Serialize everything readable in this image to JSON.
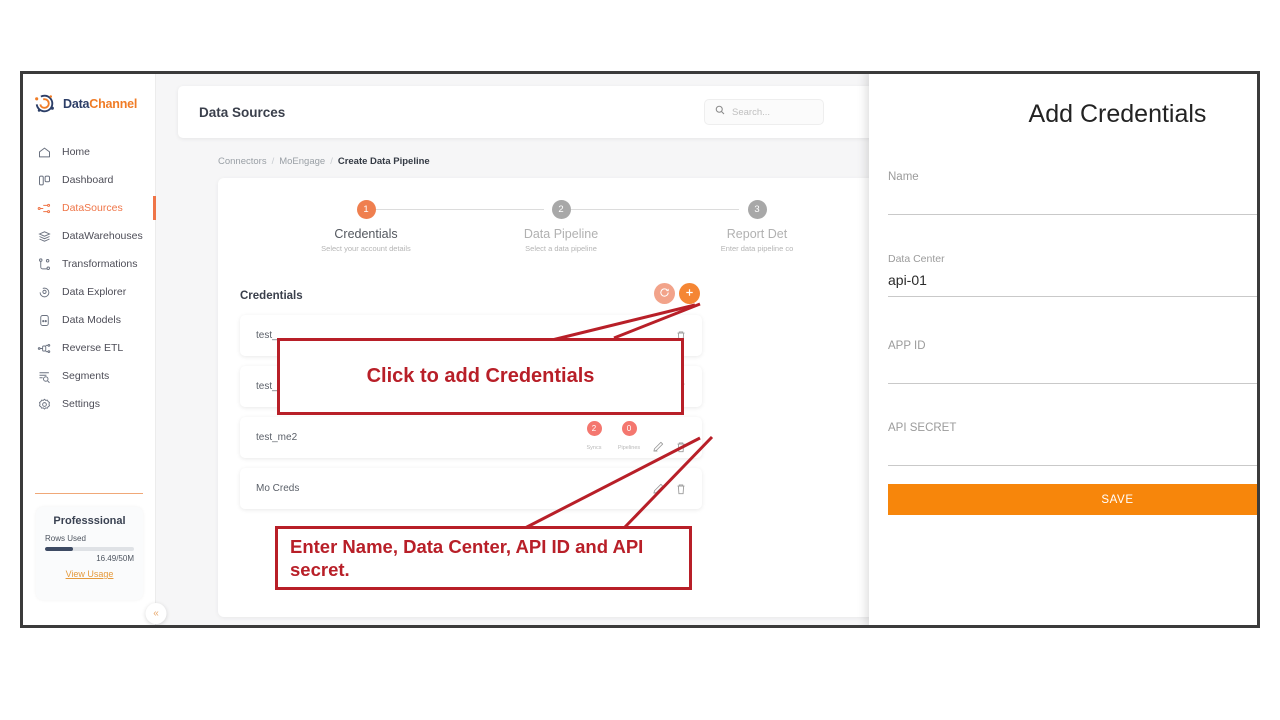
{
  "app": {
    "brand_data": "Data",
    "brand_channel": "Channel",
    "logo_icon": "datachannel-logo-icon"
  },
  "sidebar": {
    "items": [
      {
        "label": "Home",
        "icon": "home-icon",
        "active": false
      },
      {
        "label": "Dashboard",
        "icon": "dashboard-icon",
        "active": false
      },
      {
        "label": "DataSources",
        "icon": "datasources-icon",
        "active": true
      },
      {
        "label": "DataWarehouses",
        "icon": "datawarehouses-icon",
        "active": false
      },
      {
        "label": "Transformations",
        "icon": "transformations-icon",
        "active": false
      },
      {
        "label": "Data Explorer",
        "icon": "data-explorer-icon",
        "active": false
      },
      {
        "label": "Data Models",
        "icon": "data-models-icon",
        "active": false
      },
      {
        "label": "Reverse ETL",
        "icon": "reverse-etl-icon",
        "active": false
      },
      {
        "label": "Segments",
        "icon": "segments-icon",
        "active": false
      },
      {
        "label": "Settings",
        "icon": "settings-icon",
        "active": false
      }
    ],
    "plan": {
      "title": "Professsional",
      "rows_used_label": "Rows Used",
      "usage": "16.49/50M",
      "progress_percent": 32,
      "view_usage_label": "View Usage"
    },
    "collapse_label": "«"
  },
  "header": {
    "page_title": "Data Sources",
    "search_placeholder": "Search...",
    "search_value": "",
    "search_icon": "search-icon"
  },
  "breadcrumb": [
    {
      "label": "Connectors",
      "current": false
    },
    {
      "label": "MoEngage",
      "current": false
    },
    {
      "label": "Create Data Pipeline",
      "current": true
    }
  ],
  "stepper": {
    "steps": [
      {
        "number": "1",
        "title": "Credentials",
        "desc": "Select your account details",
        "active": true
      },
      {
        "number": "2",
        "title": "Data Pipeline",
        "desc": "Select a data pipeline",
        "active": false
      },
      {
        "number": "3",
        "title": "Report Det",
        "desc": "Enter data pipeline co",
        "active": false
      }
    ]
  },
  "credentials": {
    "section_title": "Credentials",
    "refresh_icon": "refresh-icon",
    "add_icon": "plus-icon",
    "rows": [
      {
        "name": "test_",
        "badges": [],
        "has_edit": false,
        "has_delete": true
      },
      {
        "name": "test_",
        "badges": [],
        "has_edit": false,
        "has_delete": true
      },
      {
        "name": "test_me2",
        "badges": [
          {
            "count": "2",
            "label": "Syncs"
          },
          {
            "count": "0",
            "label": "Pipelines"
          }
        ],
        "has_edit": true,
        "has_delete": true
      },
      {
        "name": "Mo Creds",
        "badges": [],
        "has_edit": true,
        "has_delete": true
      }
    ]
  },
  "drawer": {
    "title": "Add Credentials",
    "fields": [
      {
        "label": "Name",
        "value": "",
        "type": "text"
      },
      {
        "label": "Data Center",
        "value": "api-01",
        "type": "select"
      },
      {
        "label": "APP ID",
        "value": "",
        "type": "text"
      },
      {
        "label": "API SECRET",
        "value": "",
        "type": "text"
      }
    ],
    "save_label": "SAVE",
    "fab_icon": "chat-bubble-icon"
  },
  "annotations": [
    {
      "text": "Click to add Credentials"
    },
    {
      "text": "Enter Name, Data Center, API ID and API secret."
    }
  ],
  "colors": {
    "accent_orange": "#f58634",
    "brand_navy": "#2c3e67",
    "annotation_red": "#b81f28",
    "save_orange": "#f7860b",
    "badge_red": "#f4776f"
  }
}
